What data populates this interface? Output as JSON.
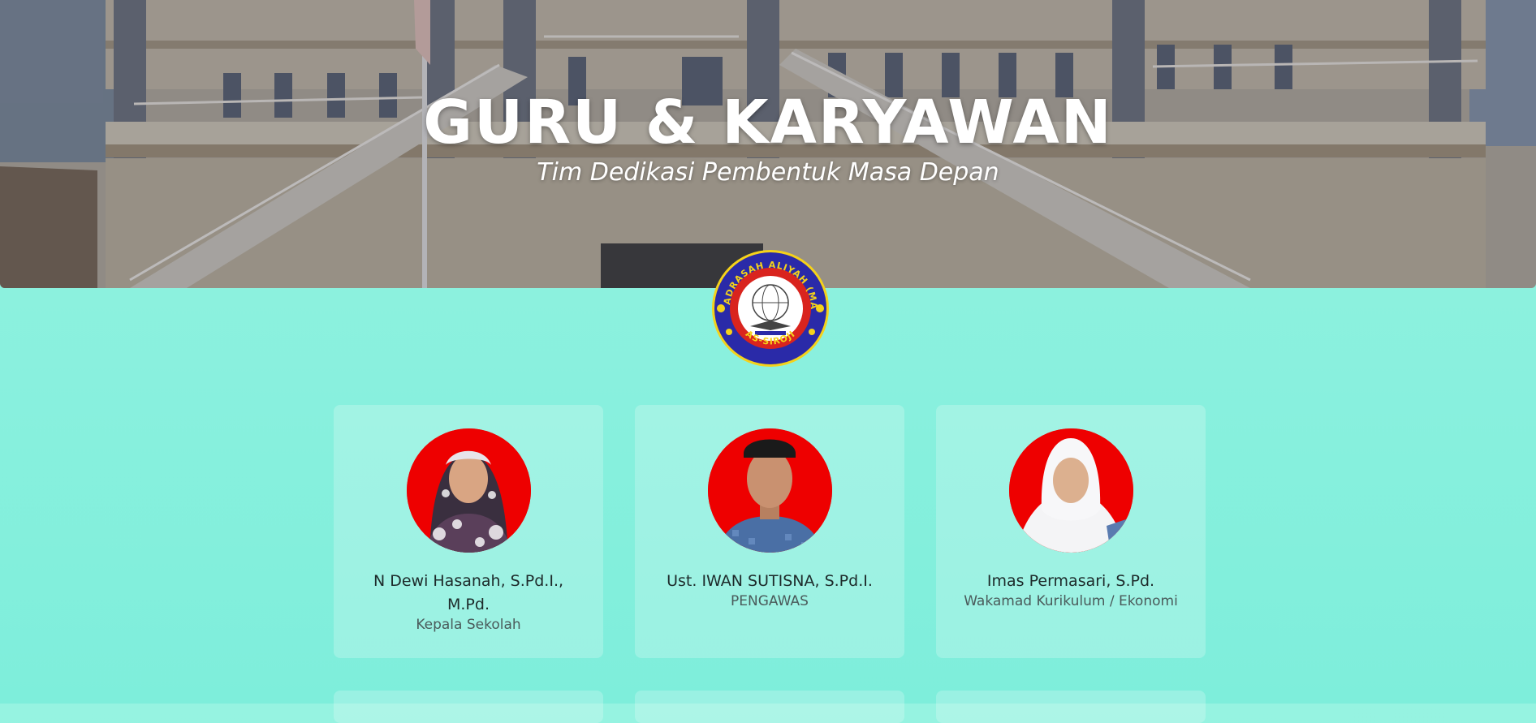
{
  "hero": {
    "title": "GURU & KARYAWAN",
    "subtitle": "Tim Dedikasi Pembentuk Masa Depan"
  },
  "logo": {
    "top_text": "MADRASAH ALIYAH (MA)",
    "bottom_text": "AS-SIROJI",
    "colors": {
      "ring": "#2a2aa8",
      "inner": "#d9241e",
      "flower": "#f5d21a"
    }
  },
  "staff": [
    {
      "name": "N Dewi Hasanah, S.Pd.I., M.Pd.",
      "role": "Kepala Sekolah"
    },
    {
      "name": "Ust. IWAN SUTISNA, S.Pd.I.",
      "role": "PENGAWAS"
    },
    {
      "name": "Imas Permasari, S.Pd.",
      "role": "Wakamad Kurikulum / Ekonomi"
    }
  ],
  "colors": {
    "page_bg": "#8ef2df",
    "photo_bg": "#ee0000"
  }
}
